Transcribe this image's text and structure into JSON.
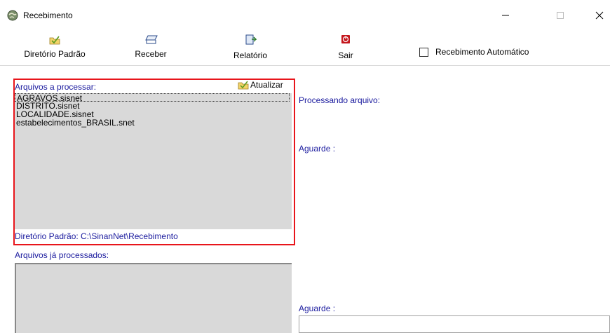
{
  "window": {
    "title": "Recebimento",
    "minimize_glyph": "—",
    "maximize_glyph": "☐",
    "close_glyph": "✕"
  },
  "toolbar": {
    "directory_label": "Diretório Padrão",
    "receive_label": "Receber",
    "report_label": "Relatório",
    "exit_label": "Sair",
    "auto_label": "Recebimento Automático",
    "auto_checked": false
  },
  "processing": {
    "title": "Arquivos a processar:",
    "refresh_label": "Atualizar",
    "files": [
      "AGRAVOS.sisnet",
      "DISTRITO.sisnet",
      "LOCALIDADE.sisnet",
      "estabelecimentos_BRASIL.snet"
    ],
    "selected_index": 0,
    "directory_text": "Diretório Padrão: C:\\SinanNet\\Recebimento"
  },
  "processed": {
    "title": "Arquivos já processados:"
  },
  "status": {
    "processing_file_label": "Processando arquivo:",
    "wait_label_1": "Aguarde :",
    "wait_label_2": "Aguarde :"
  },
  "colors": {
    "label_blue": "#1a1a9e",
    "highlight_red": "#e8151b",
    "list_gray": "#d9d9d9"
  }
}
